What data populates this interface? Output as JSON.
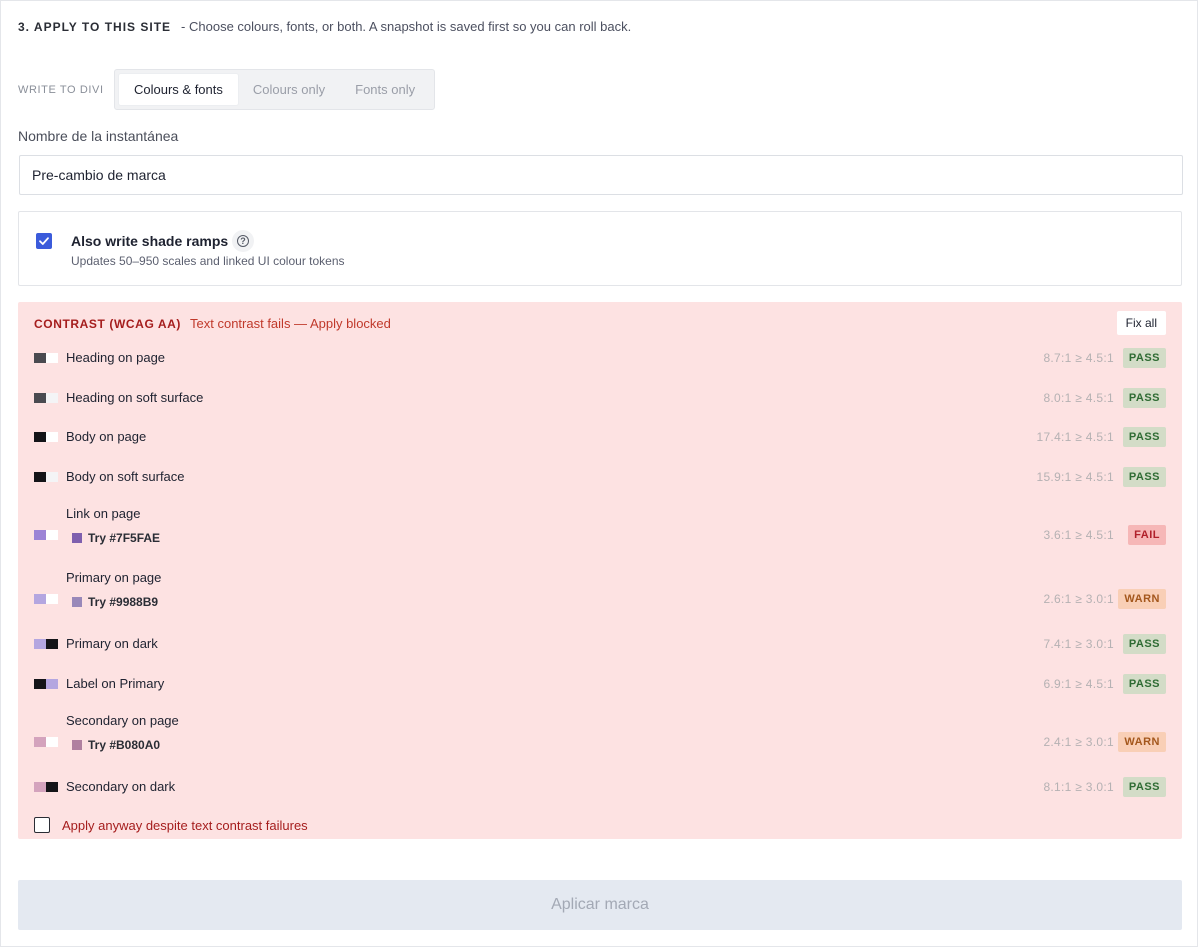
{
  "section": {
    "title": "3. APPLY TO THIS SITE",
    "description": "- Choose colours, fonts, or both. A snapshot is saved first so you can roll back."
  },
  "write_mode": {
    "label": "WRITE TO DIVI",
    "options": [
      "Colours & fonts",
      "Colours only",
      "Fonts only"
    ],
    "selected": "Colours & fonts"
  },
  "snapshot": {
    "label": "Nombre de la instantánea",
    "value": "Pre-cambio de marca"
  },
  "shade_ramps": {
    "checked": true,
    "title": "Also write shade ramps",
    "help_icon": "question-circle-icon",
    "subtitle": "Updates 50–950 scales and linked UI colour tokens"
  },
  "contrast": {
    "title": "CONTRAST (WCAG AA)",
    "status": "Text contrast fails — Apply blocked",
    "fix_all_label": "Fix all",
    "rows": [
      {
        "label": "Heading on page",
        "fg": "#4a4a50",
        "bg": "#ffffff",
        "ratio": "8.7:1 ≥ 4.5:1",
        "badge": "PASS",
        "try": null,
        "try_color": null
      },
      {
        "label": "Heading on soft surface",
        "fg": "#4a4a50",
        "bg": "#f4f4f6",
        "ratio": "8.0:1 ≥ 4.5:1",
        "badge": "PASS",
        "try": null,
        "try_color": null
      },
      {
        "label": "Body on page",
        "fg": "#141418",
        "bg": "#ffffff",
        "ratio": "17.4:1 ≥ 4.5:1",
        "badge": "PASS",
        "try": null,
        "try_color": null
      },
      {
        "label": "Body on soft surface",
        "fg": "#141418",
        "bg": "#f4f4f6",
        "ratio": "15.9:1 ≥ 4.5:1",
        "badge": "PASS",
        "try": null,
        "try_color": null
      },
      {
        "label": "Link on page",
        "fg": "#9c84d6",
        "bg": "#ffffff",
        "ratio": "3.6:1 ≥ 4.5:1",
        "badge": "FAIL",
        "try": "Try #7F5FAE",
        "try_color": "#7f5fae"
      },
      {
        "label": "Primary on page",
        "fg": "#b4a6e0",
        "bg": "#ffffff",
        "ratio": "2.6:1 ≥ 3.0:1",
        "badge": "WARN",
        "try": "Try #9988B9",
        "try_color": "#9988b9"
      },
      {
        "label": "Primary on dark",
        "fg": "#b4a6e0",
        "bg": "#141418",
        "ratio": "7.4:1 ≥ 3.0:1",
        "badge": "PASS",
        "try": null,
        "try_color": null
      },
      {
        "label": "Label on Primary",
        "fg": "#141418",
        "bg": "#b4a6e0",
        "ratio": "6.9:1 ≥ 4.5:1",
        "badge": "PASS",
        "try": null,
        "try_color": null
      },
      {
        "label": "Secondary on page",
        "fg": "#d4a3bd",
        "bg": "#ffffff",
        "ratio": "2.4:1 ≥ 3.0:1",
        "badge": "WARN",
        "try": "Try #B080A0",
        "try_color": "#b080a0"
      },
      {
        "label": "Secondary on dark",
        "fg": "#d4a3bd",
        "bg": "#141418",
        "ratio": "8.1:1 ≥ 3.0:1",
        "badge": "PASS",
        "try": null,
        "try_color": null
      }
    ],
    "apply_anyway_checked": false,
    "apply_anyway_label": "Apply anyway despite text contrast failures"
  },
  "apply_button": {
    "label": "Aplicar marca",
    "disabled": true
  }
}
